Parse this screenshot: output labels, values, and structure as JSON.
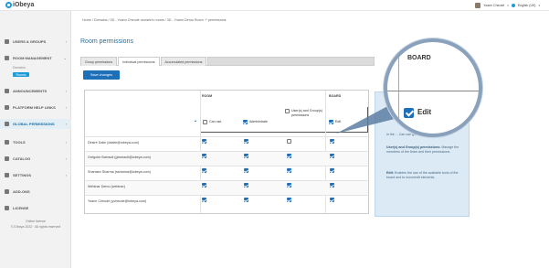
{
  "app": {
    "logo": "iObeya"
  },
  "header": {
    "user_name": "Yoann Cheudé",
    "language": "English (US)"
  },
  "sidebar": {
    "items": [
      {
        "label": "USERS & GROUPS",
        "icon": "users-icon"
      },
      {
        "label": "ROOM MANAGEMENT",
        "icon": "grid-icon"
      },
      {
        "label": "ANNOUNCEMENTS",
        "icon": "megaphone-icon"
      },
      {
        "label": "PLATFORM HELP LINKS",
        "icon": "help-icon"
      },
      {
        "label": "GLOBAL PERMISSIONS",
        "icon": "lock-icon"
      },
      {
        "label": "TOOLS",
        "icon": "tools-icon"
      },
      {
        "label": "CATALOG",
        "icon": "tag-icon"
      },
      {
        "label": "SETTINGS",
        "icon": "sliders-icon"
      },
      {
        "label": "ADD-ONS",
        "icon": "puzzle-icon"
      },
      {
        "label": "LICENSE",
        "icon": "info-icon"
      }
    ],
    "sub_domains": "Domains",
    "sub_rooms": "Rooms",
    "footer_license": "Online license",
    "footer_copyright": "© iObeya 2022 · All rights reserved"
  },
  "breadcrumb": "Home / Domains / 3D - Yoann Cheudé domain's rooms / 3D - Yoann Demo Room ↗ permissions",
  "page": {
    "title": "Room permissions"
  },
  "tabs": [
    "Group permissions",
    "Individual permissions",
    "Accumulated permissions"
  ],
  "save_label": "Save changes",
  "table": {
    "group_room": "ROOM",
    "group_board": "BOARD",
    "columns": [
      "Can use",
      "Administrate",
      "User(s) and Group(s) permissions",
      "Edit"
    ],
    "header_checks": [
      false,
      true,
      false,
      true
    ],
    "rows": [
      {
        "name": "Désiré Dalle (ddalle@iobeya.com)",
        "checks": [
          true,
          true,
          false,
          true
        ]
      },
      {
        "name": "Grégoire Barrault (gbarrault@iobeya.com)",
        "checks": [
          true,
          true,
          true,
          true
        ]
      },
      {
        "name": "Shantam Sharma (ssharma@iobeya.com)",
        "checks": [
          true,
          true,
          true,
          true
        ]
      },
      {
        "name": "Webinar Demo (webinar)",
        "checks": [
          true,
          true,
          true,
          true
        ]
      },
      {
        "name": "Yoann Cheudé (ycheude@iobeya.com)",
        "checks": [
          true,
          true,
          true,
          true
        ]
      }
    ]
  },
  "help": {
    "p1": "in the ... Can use grants navigation.",
    "p2_title": "User(s) and Group(s) permissions:",
    "p2": "Manage the members of the team and their permissions.",
    "p3_title": "Edit:",
    "p3": "Enables the use of the available tools of the board and to move/edit elements."
  },
  "magnifier": {
    "title": "BOARD",
    "edit_label": "Edit",
    "edit_checked": true
  },
  "colors": {
    "accent": "#1d6fb8",
    "brand": "#1d9bd7",
    "help_bg": "#dbeaf5"
  }
}
